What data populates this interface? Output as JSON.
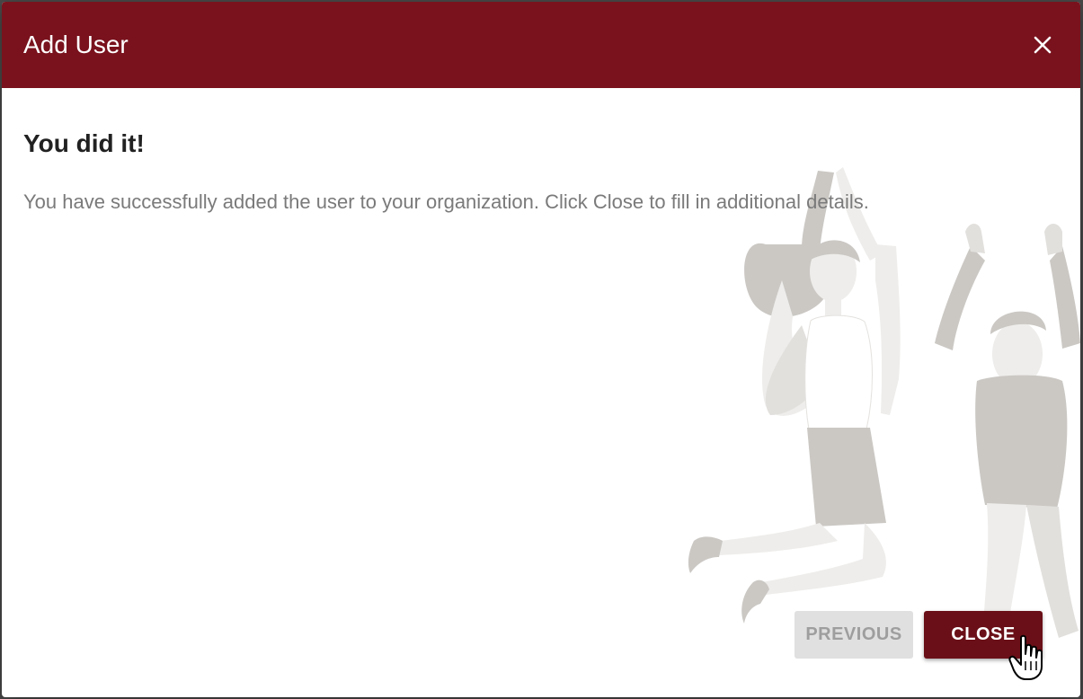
{
  "dialog": {
    "title": "Add User",
    "close_icon": "close-icon"
  },
  "content": {
    "heading": "You did it!",
    "message": "You have successfully added the user to your organization. Click Close to fill in additional details."
  },
  "actions": {
    "previous_label": "PREVIOUS",
    "close_label": "CLOSE"
  },
  "illustration": {
    "icon": "celebrating-people-illustration"
  },
  "cursor": {
    "icon": "hand-pointer-icon"
  },
  "colors": {
    "header": "#79121d",
    "primary_button": "#6a0f17",
    "secondary_button": "#e0e0e0",
    "illustration_dark": "#cbc8c4",
    "illustration_light": "#eeedeb"
  }
}
